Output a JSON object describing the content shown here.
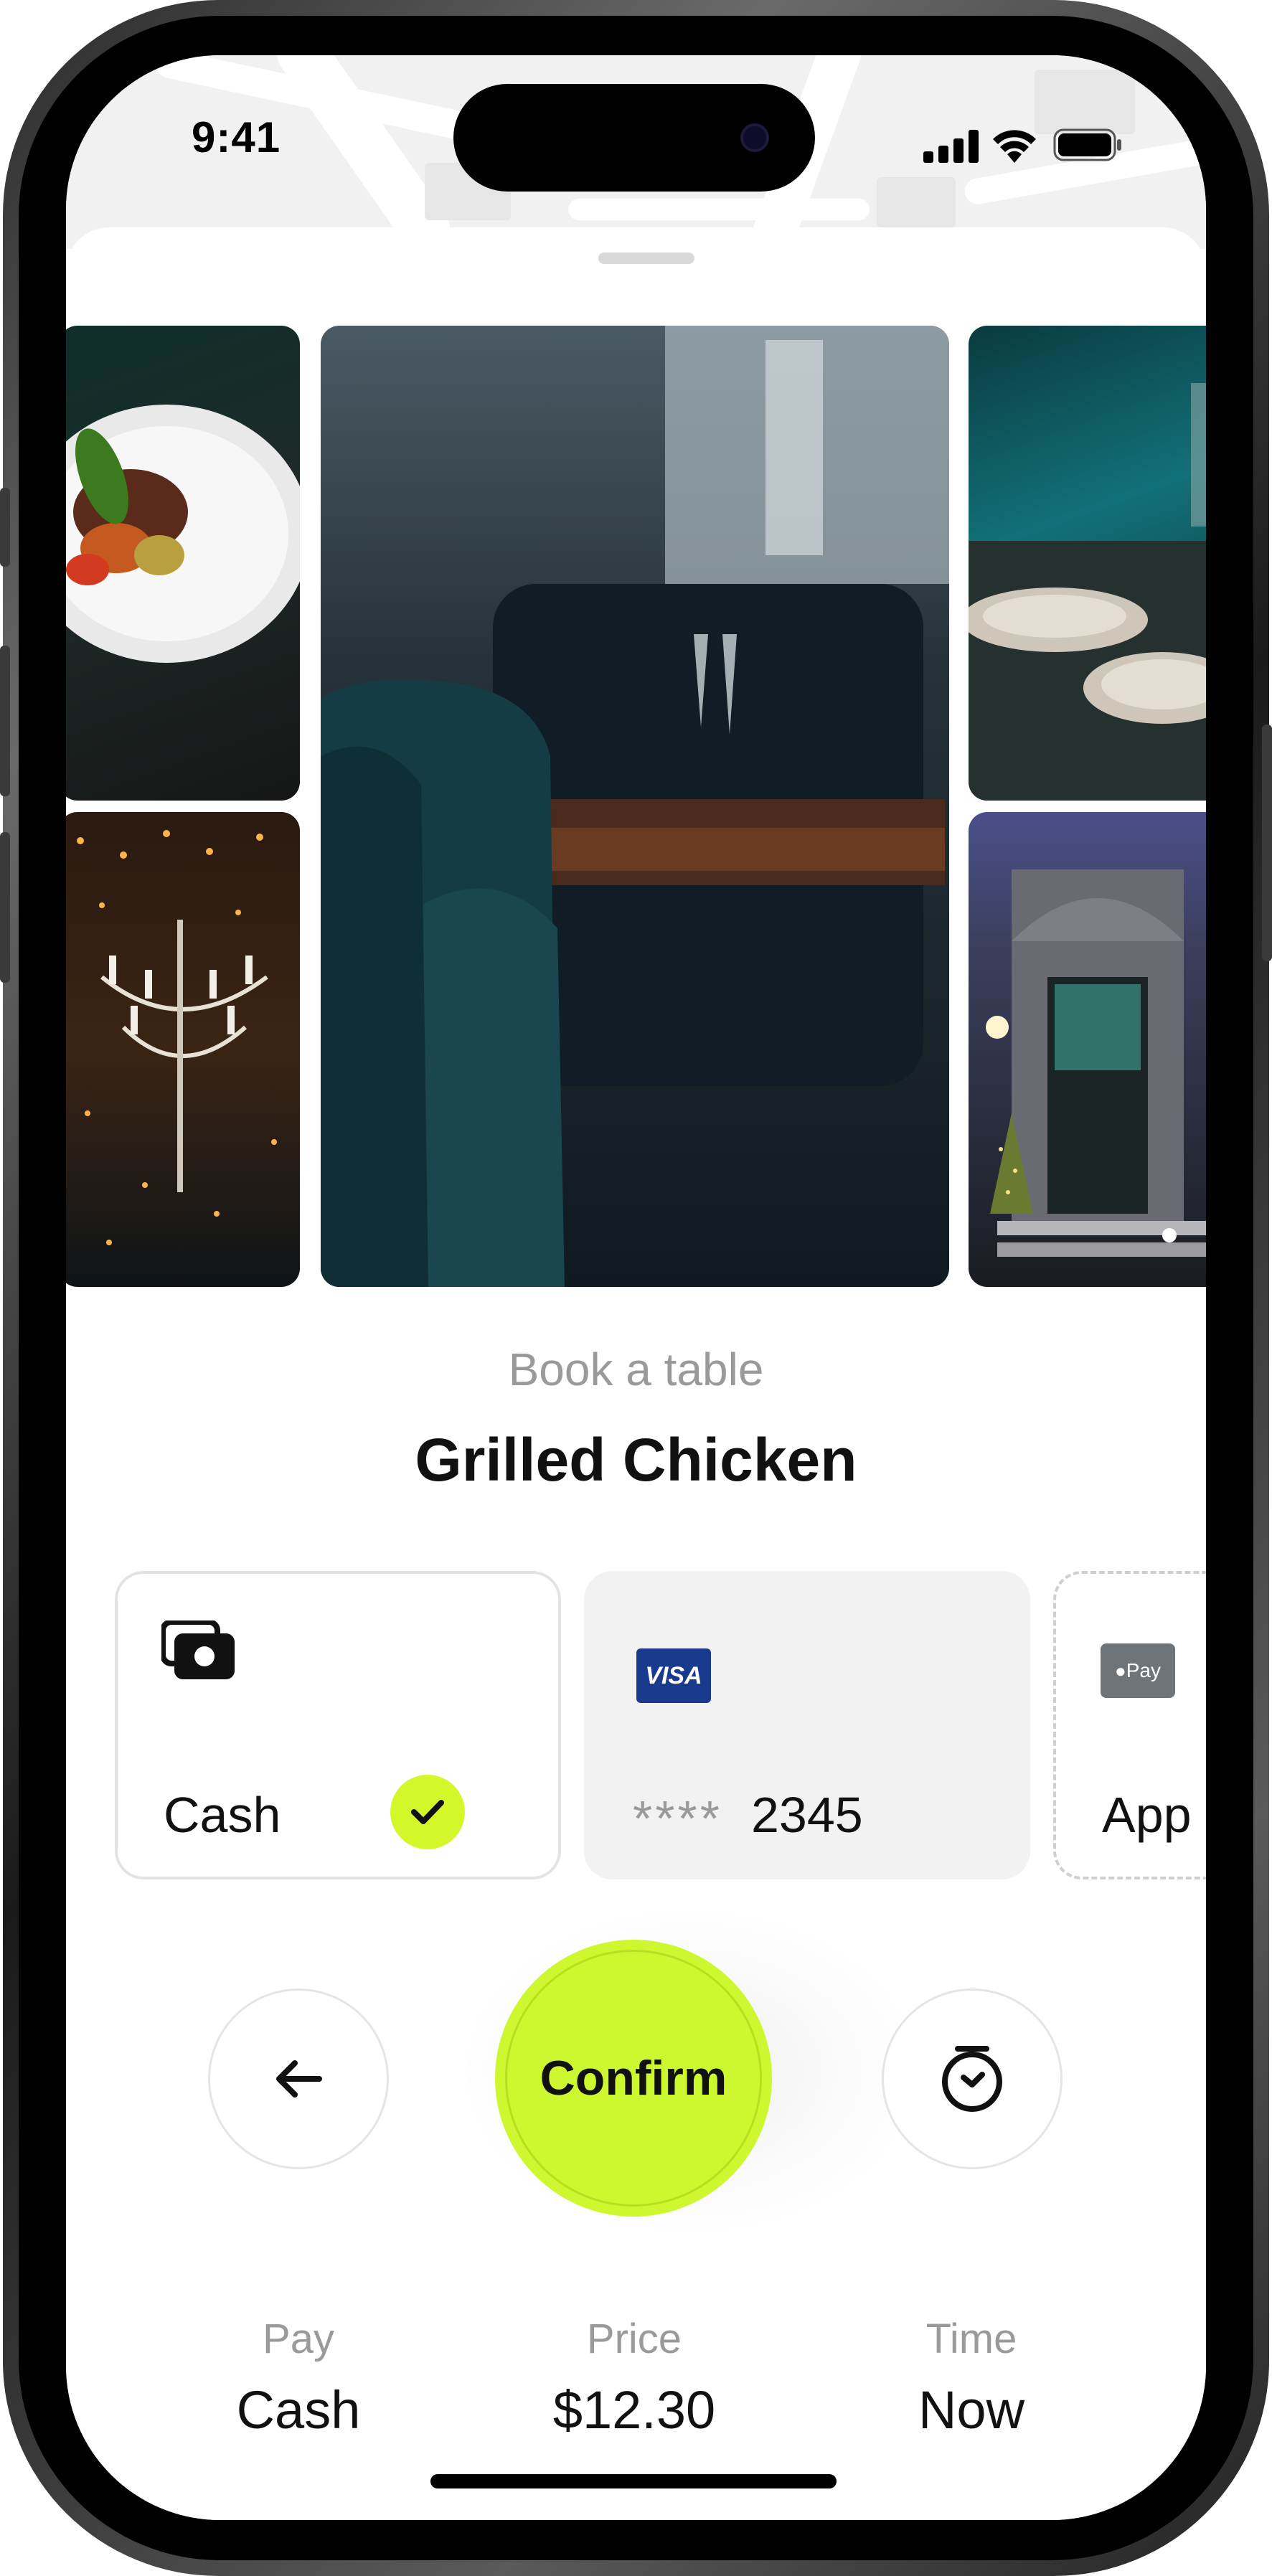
{
  "status_bar": {
    "time": "9:41",
    "icons": [
      "cellular-signal-icon",
      "wifi-icon",
      "battery-icon"
    ]
  },
  "gallery": {
    "images": [
      "octopus-dish-photo",
      "chandelier-photo",
      "wingback-chair-table-photo",
      "teal-booth-table-photo",
      "restaurant-entrance-photo"
    ]
  },
  "header": {
    "subtitle": "Book a table",
    "title": "Grilled Chicken"
  },
  "payment_methods": [
    {
      "label": "Cash",
      "icon": "cash-icon",
      "selected": true
    },
    {
      "masked": "****",
      "last4": "2345",
      "brand": "VISA",
      "selected": false
    },
    {
      "label": "App",
      "brand": "Pay",
      "selected": false
    }
  ],
  "actions": {
    "back_icon": "arrow-left-icon",
    "confirm_label": "Confirm",
    "time_icon": "clock-icon"
  },
  "summary": {
    "pay_label": "Pay",
    "pay_value": "Cash",
    "price_label": "Price",
    "price_value": "$12.30",
    "time_label": "Time",
    "time_value": "Now"
  },
  "colors": {
    "accent": "#cdf72e",
    "check_bg": "#d4f72a",
    "muted_text": "#9a9a9a",
    "visa_blue": "#1a3a8e"
  }
}
